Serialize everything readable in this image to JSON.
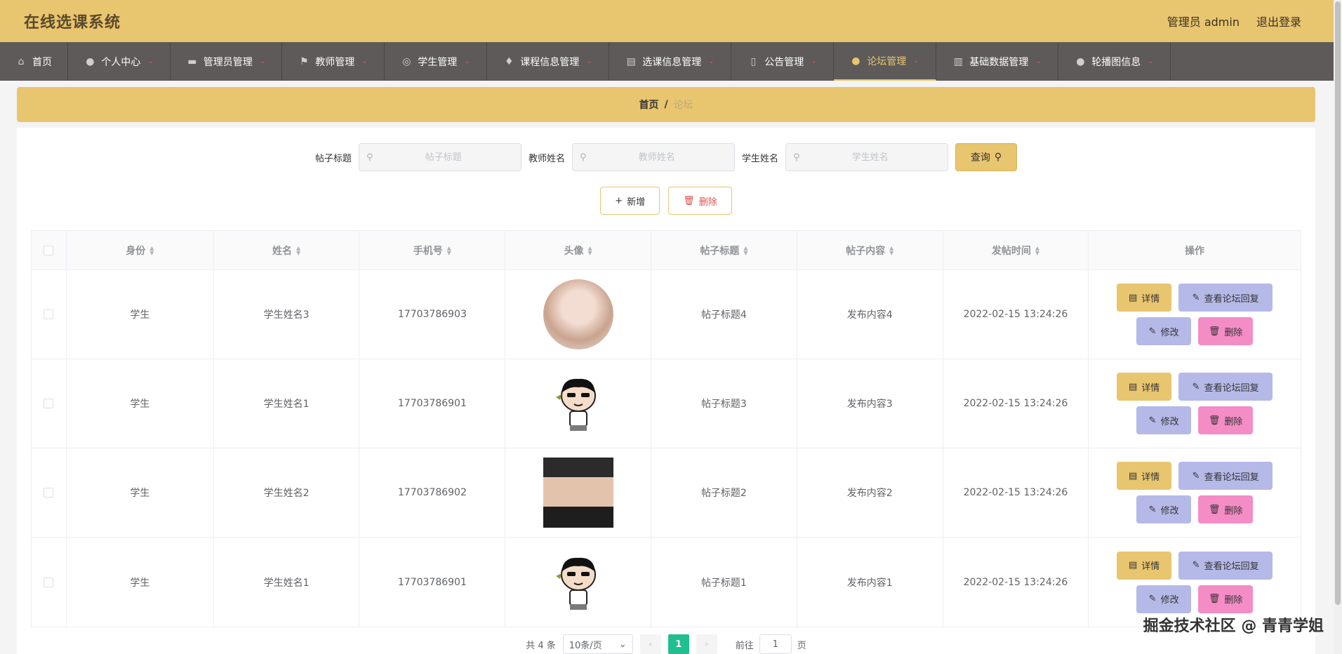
{
  "header": {
    "title": "在线选课系统",
    "user_label": "管理员 admin",
    "logout_label": "退出登录"
  },
  "nav": {
    "items": [
      {
        "label": "首页",
        "icon": "home-icon",
        "glyph": "⌂",
        "width": 97
      },
      {
        "label": "个人中心",
        "icon": "user-icon",
        "glyph": "●",
        "width": 146
      },
      {
        "label": "管理员管理",
        "icon": "id-card-icon",
        "glyph": "▬",
        "width": 159
      },
      {
        "label": "教师管理",
        "icon": "flag-icon",
        "glyph": "⚑",
        "width": 146
      },
      {
        "label": "学生管理",
        "icon": "globe-icon",
        "glyph": "◎",
        "width": 146
      },
      {
        "label": "课程信息管理",
        "icon": "mic-icon",
        "glyph": "♦",
        "width": 174
      },
      {
        "label": "选课信息管理",
        "icon": "chart-icon",
        "glyph": "▤",
        "width": 174
      },
      {
        "label": "公告管理",
        "icon": "phone-icon",
        "glyph": "▯",
        "width": 146
      },
      {
        "label": "论坛管理",
        "icon": "location-icon",
        "glyph": "●",
        "width": 146,
        "active": true
      },
      {
        "label": "基础数据管理",
        "icon": "bar-chart-icon",
        "glyph": "▥",
        "width": 174
      },
      {
        "label": "轮播图信息",
        "icon": "person-icon",
        "glyph": "●",
        "width": 160
      }
    ]
  },
  "breadcrumb": {
    "home": "首页",
    "separator": "/",
    "current": "论坛"
  },
  "search": {
    "title_label": "帖子标题",
    "title_placeholder": "帖子标题",
    "teacher_label": "教师姓名",
    "teacher_placeholder": "教师姓名",
    "student_label": "学生姓名",
    "student_placeholder": "学生姓名",
    "query_label": "查询"
  },
  "actions": {
    "add_label": "新增",
    "delete_label": "删除"
  },
  "table": {
    "headers": {
      "identity": "身份",
      "name": "姓名",
      "phone": "手机号",
      "avatar": "头像",
      "post_title": "帖子标题",
      "post_content": "帖子内容",
      "post_time": "发帖时间",
      "ops": "操作"
    },
    "rows": [
      {
        "identity": "学生",
        "name": "学生姓名3",
        "phone": "17703786903",
        "avatar": "portrait-girl",
        "post_title": "帖子标题4",
        "post_content": "发布内容4",
        "post_time": "2022-02-15 13:24:26"
      },
      {
        "identity": "学生",
        "name": "学生姓名1",
        "phone": "17703786901",
        "avatar": "cartoon-boy",
        "post_title": "帖子标题3",
        "post_content": "发布内容3",
        "post_time": "2022-02-15 13:24:26"
      },
      {
        "identity": "学生",
        "name": "学生姓名2",
        "phone": "17703786902",
        "avatar": "portrait-man",
        "post_title": "帖子标题2",
        "post_content": "发布内容2",
        "post_time": "2022-02-15 13:24:26"
      },
      {
        "identity": "学生",
        "name": "学生姓名1",
        "phone": "17703786901",
        "avatar": "cartoon-boy",
        "post_title": "帖子标题1",
        "post_content": "发布内容1",
        "post_time": "2022-02-15 13:24:26"
      }
    ],
    "op_labels": {
      "detail": "详情",
      "reply": "查看论坛回复",
      "edit": "修改",
      "delete": "删除"
    }
  },
  "pagination": {
    "total": "共 4 条",
    "page_size": "10条/页",
    "current_page": "1",
    "goto_prefix": "前往",
    "goto_value": "1",
    "goto_suffix": "页"
  },
  "watermark": {
    "corner_text": "掘金技术社区 @ 青青学姐"
  },
  "colors": {
    "accent": "#e8c56f",
    "nav_bg": "#5d5a59",
    "reply_button": "#b5b9e8",
    "delete_button": "#f48cc6",
    "pager_active": "#1fbf8f"
  }
}
